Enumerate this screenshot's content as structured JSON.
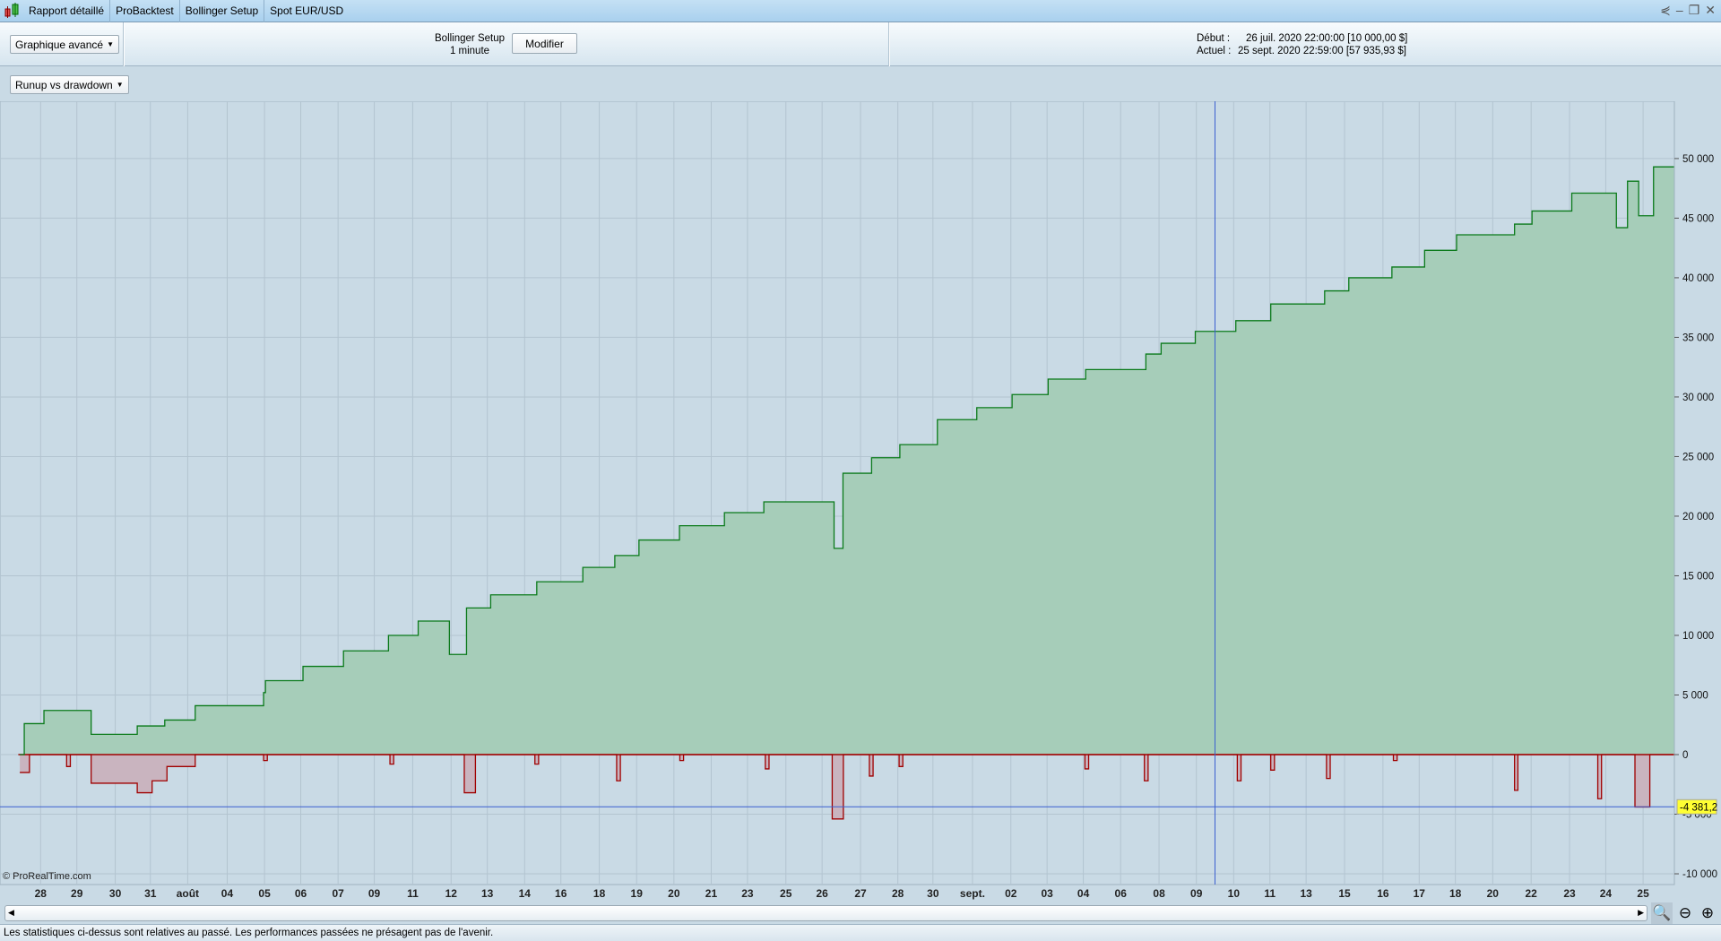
{
  "tabs": [
    {
      "label": "Rapport détaillé"
    },
    {
      "label": "ProBacktest"
    },
    {
      "label": "Bollinger Setup"
    },
    {
      "label": "Spot EUR/USD"
    }
  ],
  "toolbar": {
    "view_select": "Graphique avancé",
    "system_name": "Bollinger Setup",
    "timeframe": "1 minute",
    "modify_label": "Modifier",
    "start_label": "Début :",
    "start_value": "26 juil. 2020 22:00:00  [10 000,00 $]",
    "current_label": "Actuel :",
    "current_value": "25 sept. 2020 22:59:00  [57 935,93 $]"
  },
  "chart_select": "Runup vs drawdown",
  "watermark": "© ProRealTime.com",
  "footer": "Les statistiques ci-dessus sont relatives au passé. Les performances passées ne présagent pas de l'avenir.",
  "crosshair_value": "-4 381,2",
  "colors": {
    "runup_fill": "#a6cdb9",
    "runup_line": "#0a7a1a",
    "drawdown_fill": "#c9b4bf",
    "drawdown_line": "#a00000",
    "crosshair": "#3b5fd0",
    "highlight": "#ffff33"
  },
  "chart_data": {
    "type": "area",
    "title": "Runup vs drawdown",
    "x_tick_labels": [
      "28",
      "29",
      "30",
      "31",
      "août",
      "04",
      "05",
      "06",
      "07",
      "09",
      "11",
      "12",
      "13",
      "14",
      "16",
      "18",
      "19",
      "20",
      "21",
      "23",
      "25",
      "26",
      "27",
      "28",
      "30",
      "sept.",
      "02",
      "03",
      "04",
      "06",
      "08",
      "09",
      "10",
      "11",
      "13",
      "15",
      "16",
      "17",
      "18",
      "20",
      "22",
      "23",
      "24",
      "25"
    ],
    "y_tick_labels": [
      "50 000",
      "45 000",
      "40 000",
      "35 000",
      "30 000",
      "25 000",
      "20 000",
      "15 000",
      "10 000",
      "5 000",
      "0",
      "-5 000",
      "-10 000"
    ],
    "y_ticks": [
      50000,
      45000,
      40000,
      35000,
      30000,
      25000,
      20000,
      15000,
      10000,
      5000,
      0,
      -5000,
      -10000
    ],
    "ylim": [
      -11000,
      56000
    ],
    "xlim": [
      -1.1,
      43.9
    ],
    "grid": true,
    "runup": [
      [
        -0.56,
        0
      ],
      [
        -0.44,
        2600
      ],
      [
        0.09,
        3700
      ],
      [
        1.21,
        3700
      ],
      [
        1.36,
        1700
      ],
      [
        2.45,
        1700
      ],
      [
        2.6,
        2400
      ],
      [
        3.34,
        2900
      ],
      [
        4.16,
        4100
      ],
      [
        5.85,
        4100
      ],
      [
        6.0,
        5200
      ],
      [
        6.05,
        6200
      ],
      [
        7.06,
        7400
      ],
      [
        8.15,
        8700
      ],
      [
        9.36,
        10000
      ],
      [
        10.16,
        11200
      ],
      [
        11.0,
        8400
      ],
      [
        11.46,
        12300
      ],
      [
        12.11,
        13400
      ],
      [
        13.35,
        14500
      ],
      [
        14.59,
        15700
      ],
      [
        15.45,
        16700
      ],
      [
        16.1,
        18000
      ],
      [
        17.19,
        19200
      ],
      [
        18.4,
        20300
      ],
      [
        19.46,
        21200
      ],
      [
        21.06,
        21200
      ],
      [
        21.35,
        17300
      ],
      [
        21.59,
        23600
      ],
      [
        22.36,
        24900
      ],
      [
        23.12,
        26000
      ],
      [
        24.13,
        28100
      ],
      [
        25.19,
        29100
      ],
      [
        26.14,
        30200
      ],
      [
        27.11,
        31500
      ],
      [
        28.12,
        32300
      ],
      [
        29.6,
        32300
      ],
      [
        29.74,
        33600
      ],
      [
        30.15,
        34500
      ],
      [
        31.07,
        35500
      ],
      [
        32.16,
        36400
      ],
      [
        33.1,
        37800
      ],
      [
        34.55,
        38900
      ],
      [
        35.2,
        40000
      ],
      [
        36.36,
        40900
      ],
      [
        37.24,
        42300
      ],
      [
        38.1,
        43600
      ],
      [
        39.66,
        44500
      ],
      [
        40.13,
        45600
      ],
      [
        41.2,
        47100
      ],
      [
        42.2,
        47100
      ],
      [
        42.4,
        44200
      ],
      [
        42.7,
        48100
      ],
      [
        43.0,
        45200
      ],
      [
        43.4,
        49300
      ],
      [
        43.95,
        49300
      ]
    ],
    "drawdown": [
      [
        -0.56,
        -1500
      ],
      [
        -0.3,
        0
      ],
      [
        0.7,
        -1000
      ],
      [
        0.8,
        0
      ],
      [
        1.21,
        0
      ],
      [
        1.36,
        -2400
      ],
      [
        2.45,
        -2400
      ],
      [
        2.6,
        -3200
      ],
      [
        3.0,
        -2200
      ],
      [
        3.4,
        -1000
      ],
      [
        4.16,
        0
      ],
      [
        6.0,
        -500
      ],
      [
        6.1,
        0
      ],
      [
        9.4,
        -800
      ],
      [
        9.5,
        0
      ],
      [
        11.4,
        -3200
      ],
      [
        11.7,
        0
      ],
      [
        13.3,
        -800
      ],
      [
        13.4,
        0
      ],
      [
        15.5,
        -2200
      ],
      [
        15.6,
        0
      ],
      [
        17.2,
        -500
      ],
      [
        17.3,
        0
      ],
      [
        19.5,
        -1200
      ],
      [
        19.6,
        0
      ],
      [
        21.3,
        -5400
      ],
      [
        21.6,
        0
      ],
      [
        22.3,
        -1800
      ],
      [
        22.4,
        0
      ],
      [
        23.1,
        -1000
      ],
      [
        23.2,
        0
      ],
      [
        28.1,
        -1200
      ],
      [
        28.2,
        0
      ],
      [
        29.7,
        -2200
      ],
      [
        29.8,
        0
      ],
      [
        32.2,
        -2200
      ],
      [
        32.3,
        0
      ],
      [
        33.1,
        -1300
      ],
      [
        33.2,
        0
      ],
      [
        34.6,
        -2000
      ],
      [
        34.7,
        0
      ],
      [
        36.4,
        -500
      ],
      [
        36.5,
        0
      ],
      [
        39.66,
        -3000
      ],
      [
        39.75,
        0
      ],
      [
        41.9,
        -3700
      ],
      [
        42.0,
        0
      ],
      [
        42.9,
        -4400
      ],
      [
        43.3,
        0
      ],
      [
        43.95,
        0
      ]
    ],
    "crosshair": {
      "x": 31.6,
      "y": -4381.2
    }
  }
}
